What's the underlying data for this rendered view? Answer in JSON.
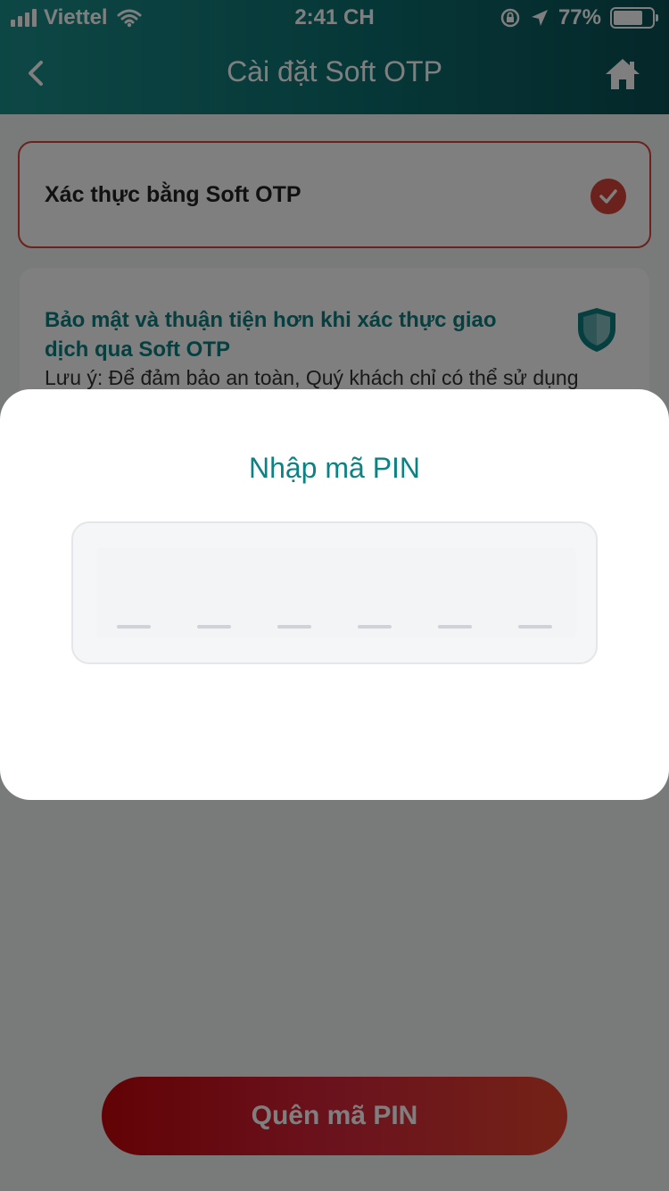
{
  "status_bar": {
    "carrier": "Viettel",
    "time": "2:41 CH",
    "battery_percent_label": "77%",
    "battery_level": 0.77
  },
  "nav": {
    "title": "Cài đặt Soft OTP",
    "back_icon": "chevron-left-icon",
    "home_icon": "home-icon"
  },
  "option": {
    "label": "Xác thực bằng Soft OTP",
    "checked": true
  },
  "info": {
    "title": "Bảo mật và thuận tiện hơn khi xác thực giao dịch qua Soft OTP",
    "note": "Lưu ý: Để đảm bảo an toàn, Quý khách chỉ có thể sử dụng"
  },
  "pin_modal": {
    "title": "Nhập mã PIN",
    "pin_length": 6,
    "entered_digits": 0
  },
  "forgot_pin_label": "Quên mã PIN",
  "colors": {
    "teal": "#0d8283",
    "red": "#d6453a",
    "overlay": "rgba(0,0,0,0.5)"
  }
}
